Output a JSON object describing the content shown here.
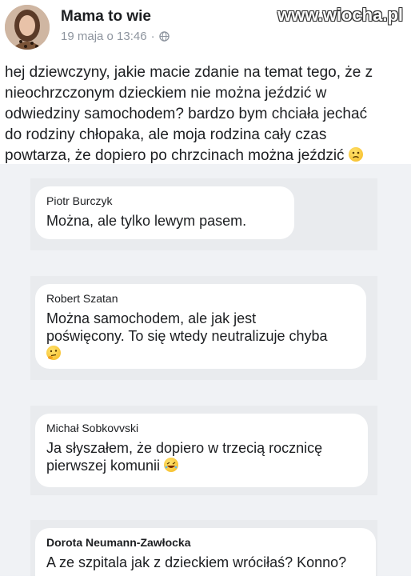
{
  "post": {
    "author": "Mama to wie",
    "date": "19 maja o 13:46",
    "separator": "·",
    "privacy_icon": "globe-icon",
    "watermark": "www.wiocha.pl",
    "lines": [
      "hej dziewczyny, jakie macie zdanie na temat tego, że z",
      "nieochrzczonym dzieckiem nie można jeździć w",
      "odwiedziny samochodem? bardzo bym chciała jechać",
      "do rodziny chłopaka, ale moja rodzina cały czas",
      "powtarza, że dopiero po chrzcinach można jeździć"
    ],
    "emoji": "confused-face-emoji"
  },
  "comments": [
    {
      "name": "Piotr Burczyk",
      "lines": [
        "Można, ale tylko lewym pasem."
      ]
    },
    {
      "name": "Robert Szatan",
      "lines": [
        "Można samochodem, ale jak jest",
        "poświęcony. To się wtedy neutralizuje chyba"
      ],
      "emoji": "thinking-face-emoji"
    },
    {
      "name": "Michał Sobkovvski",
      "lines": [
        "Ja słyszałem, że dopiero w trzecią rocznicę",
        "pierwszej komunii"
      ],
      "emoji": "rolling-laughing-emoji"
    },
    {
      "name": "Dorota Neumann-Zawłocka",
      "lines": [
        "A ze szpitala jak z dzieckiem wróciłaś? Konno?"
      ]
    }
  ],
  "colors": {
    "background": "#ffffff",
    "comment_area": "#f0f2f5",
    "bubble": "#ffffff",
    "meta_text": "#8d949e"
  }
}
